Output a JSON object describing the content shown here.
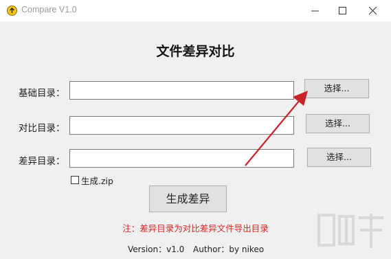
{
  "window": {
    "title": "Compare V1.0",
    "controls": {
      "minimize_icon": "minimize-icon",
      "maximize_icon": "maximize-icon",
      "close_icon": "close-icon"
    }
  },
  "heading": "文件差异对比",
  "fields": [
    {
      "label": "基础目录：",
      "value": "",
      "button_label": "选择..."
    },
    {
      "label": "对比目录：",
      "value": "",
      "button_label": "选择..."
    },
    {
      "label": "差异目录：",
      "value": "",
      "button_label": "选择..."
    }
  ],
  "zip_option": {
    "label": "生成.zip",
    "checked": false
  },
  "generate_button": "生成差异",
  "note": "注：差异目录为对比差异文件导出目录",
  "footer": {
    "version": "Version：v1.0",
    "author": "Author：by nikeo"
  },
  "colors": {
    "note": "#d62a2a",
    "annotation_arrow": "#c8222a"
  }
}
